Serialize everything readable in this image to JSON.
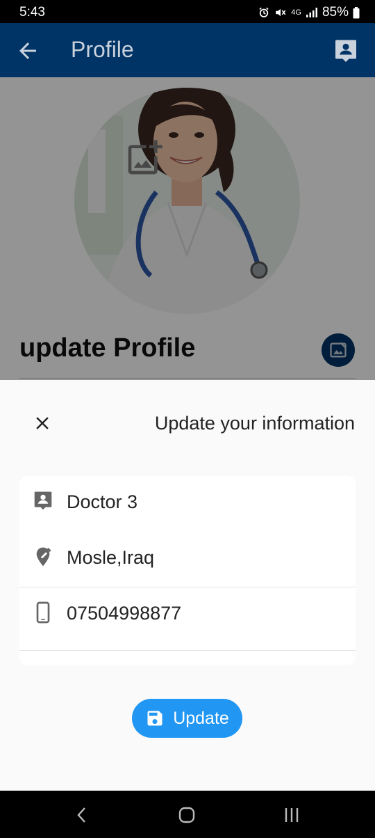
{
  "status": {
    "time": "5:43",
    "network": "4G",
    "battery": "85%"
  },
  "app_bar": {
    "title": "Profile"
  },
  "profile": {
    "heading": "update Profile"
  },
  "sheet": {
    "title": "Update your information",
    "fields": [
      {
        "icon": "person-icon",
        "value": "Doctor 3"
      },
      {
        "icon": "location-edit-icon",
        "value": "Mosle,Iraq"
      },
      {
        "icon": "phone-icon",
        "value": "07504998877"
      }
    ],
    "button_label": "Update"
  },
  "colors": {
    "app_bar": "#003366",
    "accent": "#2196f3",
    "sheet_bg": "#fafafa"
  }
}
